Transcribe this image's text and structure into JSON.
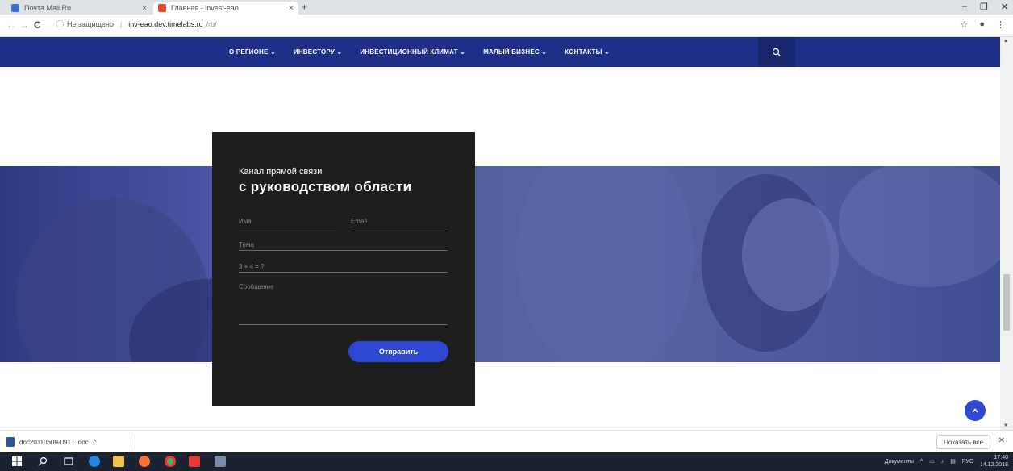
{
  "browser": {
    "tabs": [
      {
        "title": "Почта Mail.Ru",
        "close": "×"
      },
      {
        "title": "Главная - invest-eao",
        "close": "×"
      }
    ],
    "new_tab": "+",
    "window_controls": {
      "minimize": "–",
      "restore": "❐",
      "close": "✕"
    },
    "nav": {
      "back": "←",
      "forward": "→",
      "reload": "C"
    },
    "address": {
      "security_icon": "ⓘ",
      "security_text": "Не защищено",
      "separator": "|",
      "host": "inv-eao.dev.timelabs.ru",
      "path": "/ru/"
    },
    "right_icons": {
      "bookmark": "☆",
      "account": "●",
      "menu": "⋮"
    }
  },
  "site_nav": {
    "items": [
      "О РЕГИОНЕ ⌄",
      "ИНВЕСТОРУ ⌄",
      "ИНВЕСТИЦИОННЫЙ КЛИМАТ ⌄",
      "МАЛЫЙ БИЗНЕС ⌄",
      "КОНТАКТЫ ⌄"
    ]
  },
  "form": {
    "subtitle": "Канал прямой связи",
    "title": "с руководством области",
    "name_placeholder": "Имя",
    "email_placeholder": "Email",
    "subject_placeholder": "Тема",
    "captcha_placeholder": "3 + 4 = ?",
    "message_placeholder": "Сообщение",
    "submit_label": "Отправить"
  },
  "downloads": {
    "file_name": "doc20110609-091....doc",
    "chevron": "^",
    "show_all": "Показать все",
    "close": "✕"
  },
  "taskbar": {
    "tray_label": "Документы",
    "lang": "РУС",
    "time": "17:40",
    "date": "14.12.2018"
  },
  "colors": {
    "nav_bg": "#1f2f87",
    "accent": "#2f48d4",
    "form_bg": "#1e1e1e"
  }
}
